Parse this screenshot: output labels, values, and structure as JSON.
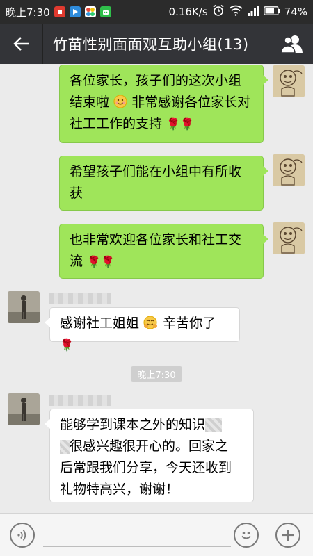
{
  "status_bar": {
    "time": "晚上7:30",
    "network_speed": "0.16K/s",
    "battery": "74%",
    "icons": [
      "notification-icon",
      "video-app-icon",
      "multicolor-app-icon",
      "android-app-icon",
      "alarm-icon",
      "wifi-icon",
      "signal-icon",
      "battery-icon"
    ]
  },
  "header": {
    "title": "竹苗性别面面观互助小组(13)"
  },
  "messages": {
    "m1": {
      "line1": "各位家长，孩子们的这次小组",
      "line2": "结束啦",
      "line2b": "非常感谢各位家长对",
      "line3": "社工工作的支持"
    },
    "m2": {
      "line1": "希望孩子们能在小组中有所收",
      "line2": "获"
    },
    "m3": {
      "line1": "也非常欢迎各位家长和社工交",
      "line2": "流"
    },
    "m4": {
      "text_a": "感谢社工姐姐",
      "text_b": "辛苦你了"
    },
    "m5": {
      "line1": "能够学到课本之外的知识",
      "line2": "很感兴趣很开心的。回家之",
      "line3": "后常跟我们分享，今天还收到",
      "line4": "礼物特高兴，谢谢！"
    }
  },
  "time_divider": "晚上7:30",
  "input": {
    "placeholder": ""
  },
  "colors": {
    "outgoing_bubble": "#9fe55a",
    "incoming_bubble": "#ffffff",
    "header_bg": "#333438"
  }
}
